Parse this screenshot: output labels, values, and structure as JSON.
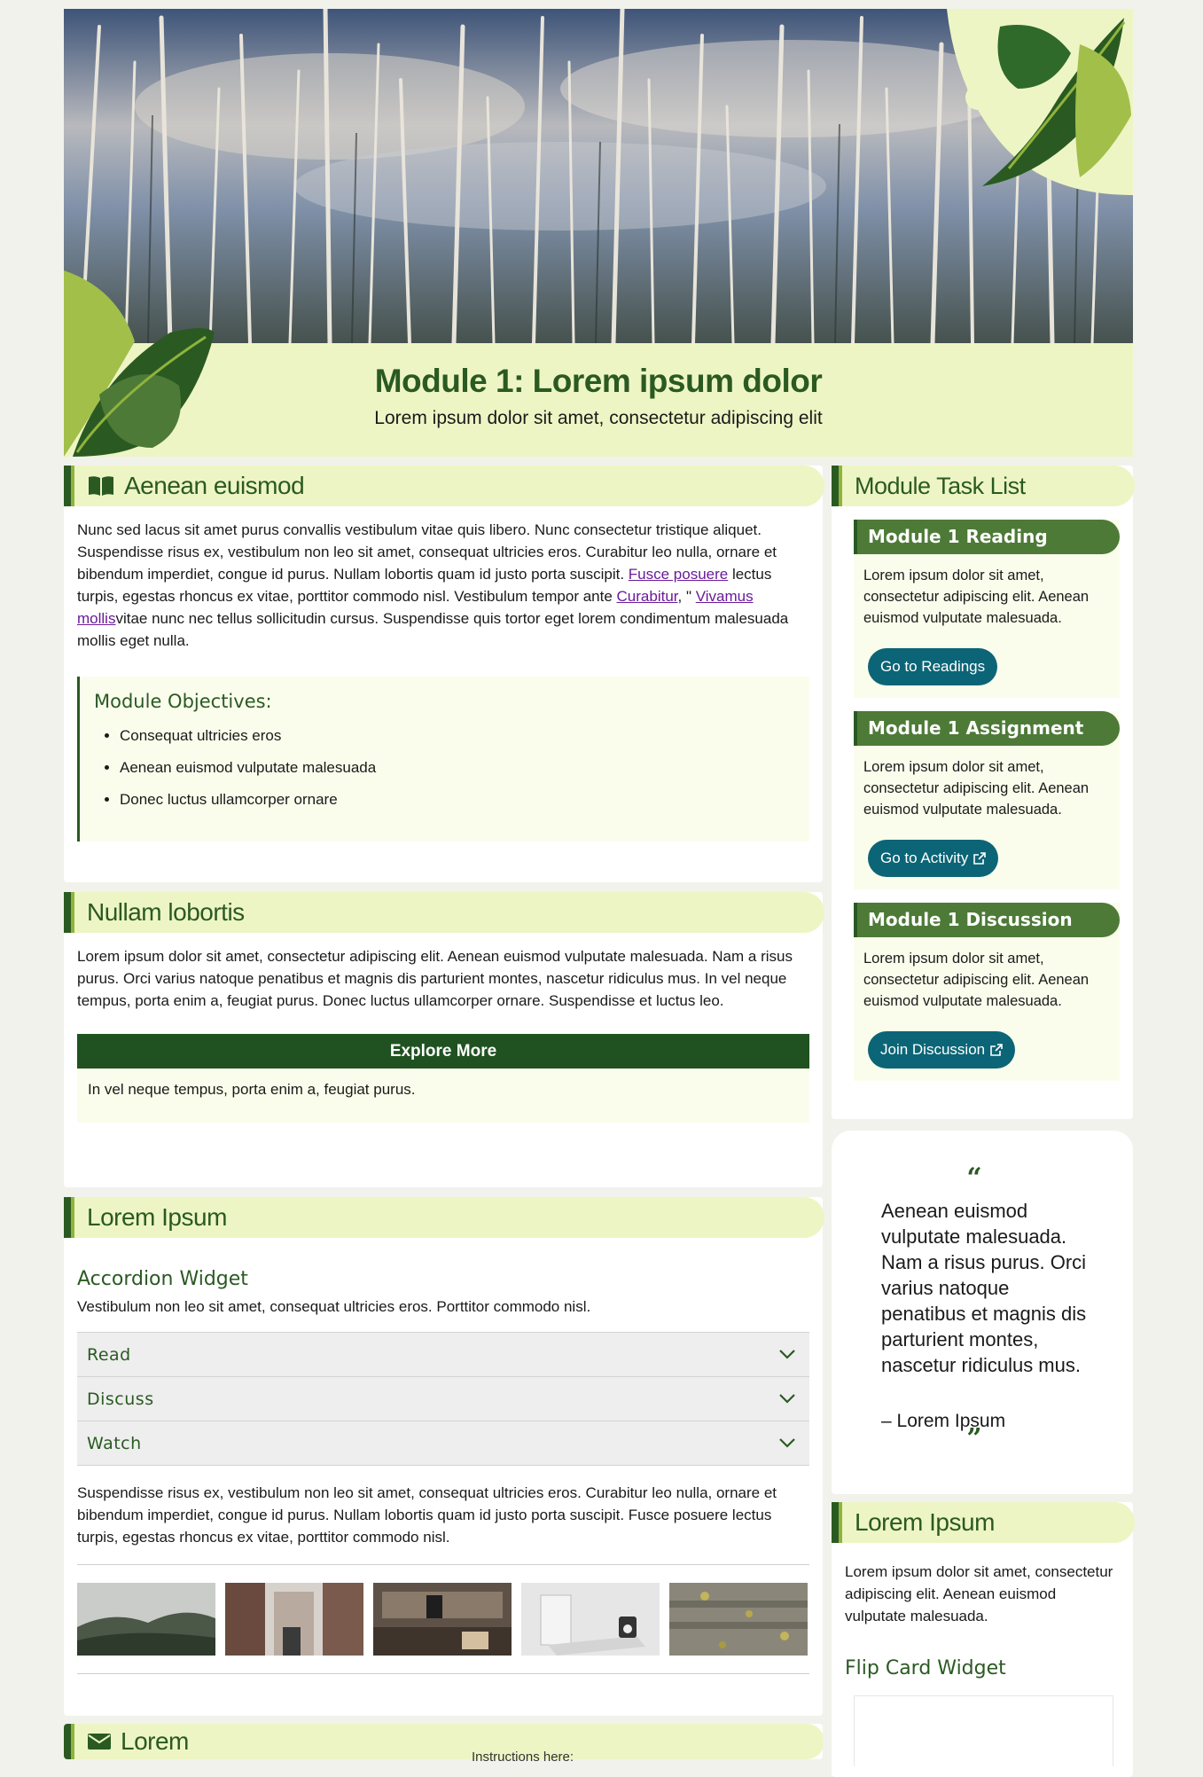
{
  "banner": {
    "title": "Module 1: Lorem ipsum dolor",
    "subtitle": "Lorem ipsum dolor sit amet, consectetur adipiscing elit"
  },
  "section1": {
    "heading": "Aenean euismod",
    "icon": "book-icon",
    "para_part1": "Nunc sed lacus sit amet purus convallis vestibulum vitae quis libero. Nunc consectetur tristique aliquet. Suspendisse risus ex, vestibulum non leo sit amet, consequat ultricies eros. Curabitur leo nulla, ornare et bibendum imperdiet, congue id purus. Nullam lobortis quam id justo porta suscipit. ",
    "link1": "Fusce posuere",
    "para_part2": " lectus turpis, egestas rhoncus ex vitae, porttitor commodo nisl. Vestibulum tempor ante ",
    "link2": "Curabitur",
    "para_part3": ", \" ",
    "link3": "Vivamus mollis",
    "para_part4": "vitae nunc nec tellus sollicitudin cursus. Suspendisse quis tortor eget lorem condimentum malesuada mollis eget nulla.",
    "objectives_title": "Module Objectives:",
    "objectives": [
      "Consequat ultricies eros",
      "Aenean euismod vulputate malesuada",
      "Donec luctus ullamcorper ornare"
    ]
  },
  "section2": {
    "heading": "Nullam lobortis",
    "para": "Lorem ipsum dolor sit amet, consectetur adipiscing elit. Aenean euismod vulputate malesuada. Nam a risus purus. Orci varius natoque penatibus et magnis dis parturient montes, nascetur ridiculus mus. In vel neque tempus, porta enim a, feugiat purus. Donec luctus ullamcorper ornare. Suspendisse et luctus leo.",
    "explore_label": "Explore More",
    "explore_text": "In vel neque tempus, porta enim a, feugiat purus."
  },
  "section3": {
    "heading": "Lorem Ipsum",
    "accordion_title": "Accordion Widget",
    "accordion_intro": "Vestibulum non leo sit amet, consequat ultricies eros. Porttitor commodo nisl.",
    "accordion_items": [
      "Read",
      "Discuss",
      "Watch"
    ],
    "para": "Suspendisse risus ex, vestibulum non leo sit amet, consequat ultricies eros. Curabitur leo nulla, ornare et bibendum imperdiet, congue id purus. Nullam lobortis quam id justo porta suscipit. Fusce posuere lectus turpis, egestas rhoncus ex vitae, porttitor commodo nisl."
  },
  "section4": {
    "heading": "Lorem",
    "icon": "envelope-icon",
    "peek_text": "Instructions here:"
  },
  "sidebar": {
    "task_list_title": "Module Task List",
    "tasks": [
      {
        "title": "Module 1 Reading",
        "desc": "Lorem ipsum dolor sit amet, consectetur adipiscing elit. Aenean euismod vulputate malesuada.",
        "button": "Go to Readings"
      },
      {
        "title": "Module 1 Assignment",
        "desc": "Lorem ipsum dolor sit amet, consectetur adipiscing elit. Aenean euismod vulputate malesuada.",
        "button": "Go to Activity"
      },
      {
        "title": "Module 1 Discussion",
        "desc": "Lorem ipsum dolor sit amet, consectetur adipiscing elit. Aenean euismod vulputate malesuada.",
        "button": "Join Discussion"
      }
    ],
    "quote": {
      "open_mark": "“",
      "text": "Aenean euismod vulputate malesuada. Nam a risus purus. Orci varius natoque penatibus et magnis dis parturient montes, nascetur ridiculus mus.",
      "attribution": "– Lorem Ipsum",
      "close_mark": "”"
    },
    "lorem": {
      "heading": "Lorem Ipsum",
      "para": "Lorem ipsum dolor sit amet, consectetur adipiscing elit. Aenean euismod vulputate malesuada.",
      "flip_title": "Flip Card Widget"
    }
  },
  "colors": {
    "primary_green": "#2a5a22",
    "light_green": "#eef5c4",
    "task_green": "#4d7a37",
    "button_teal": "#0b6576",
    "explore_bar": "#1f5220"
  }
}
